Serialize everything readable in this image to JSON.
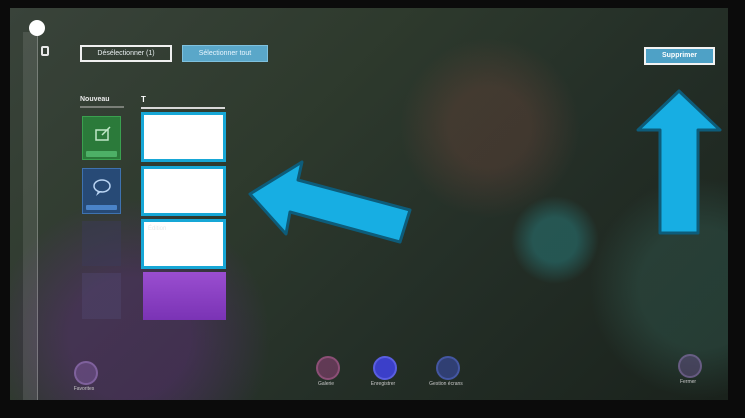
{
  "toolbar": {
    "deselect_label": "Désélectionner (1)",
    "select_all_label": "Sélectionner tout",
    "delete_label": "Supprimer"
  },
  "columns": {
    "new_title": "Nouveau",
    "second_title": "T"
  },
  "tiles": {
    "white_labels": [
      "",
      "",
      "Édition"
    ]
  },
  "bottom_bar": {
    "items": [
      {
        "label": "Favorites",
        "icon": "star-icon"
      },
      {
        "label": "Galerie",
        "icon": "gallery-icon"
      },
      {
        "label": "Enregistrer",
        "icon": "save-icon"
      },
      {
        "label": "Gestion écrans",
        "icon": "screens-icon"
      },
      {
        "label": "Fermer",
        "icon": "close-icon"
      }
    ]
  },
  "colors": {
    "accent": "#17a7d6",
    "delete_button": "#4ea1c6",
    "arrow": "#17aee3"
  }
}
